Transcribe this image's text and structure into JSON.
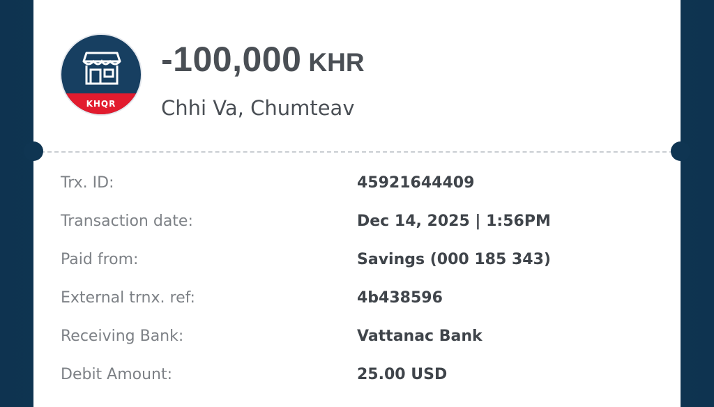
{
  "transaction": {
    "amount": "-100,000",
    "currency": "KHR",
    "merchant_name": "Chhi Va, Chumteav"
  },
  "logo": {
    "icon": "store-icon",
    "badge_text": "KHQR",
    "colors": {
      "top": "#173f61",
      "bottom": "#e21b2e"
    }
  },
  "details": [
    {
      "label": "Trx. ID:",
      "value": "45921644409"
    },
    {
      "label": "Transaction date:",
      "value": "Dec 14, 2025 | 1:56PM"
    },
    {
      "label": "Paid from:",
      "value": "Savings (000 185 343)"
    },
    {
      "label": "External trnx. ref:",
      "value": "4b438596"
    },
    {
      "label": "Receiving Bank:",
      "value": "Vattanac Bank"
    },
    {
      "label": "Debit Amount:",
      "value": "25.00 USD"
    }
  ],
  "colors": {
    "background": "#0f3552",
    "card": "#ffffff",
    "label_text": "#7d8186",
    "value_text": "#3f444a"
  }
}
